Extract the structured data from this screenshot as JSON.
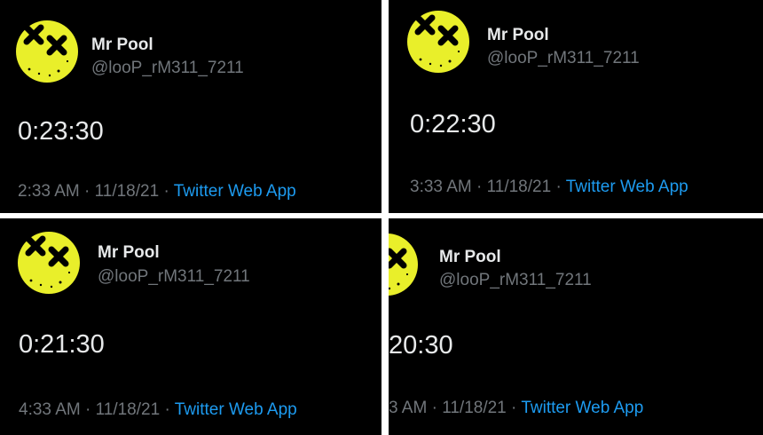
{
  "colors": {
    "background": "#000000",
    "divider": "#ffffff",
    "name": "#e7e9ea",
    "secondary": "#71767b",
    "link": "#1d9bf0",
    "avatar_face": "#e9ef2a"
  },
  "tweets": [
    {
      "name": "Mr Pool",
      "handle": "@looP_rM311_7211",
      "text": "0:23:30",
      "time": "2:33 AM",
      "sep1": "·",
      "date": "11/18/21",
      "sep2": "·",
      "source": "Twitter Web App",
      "avatar_icon": "dizzy-face-icon"
    },
    {
      "name": "Mr Pool",
      "handle": "@looP_rM311_7211",
      "text": "0:22:30",
      "time": "3:33 AM",
      "sep1": "·",
      "date": "11/18/21",
      "sep2": "·",
      "source": "Twitter Web App",
      "avatar_icon": "dizzy-face-icon"
    },
    {
      "name": "Mr Pool",
      "handle": "@looP_rM311_7211",
      "text": "0:21:30",
      "time": "4:33 AM",
      "sep1": "·",
      "date": "11/18/21",
      "sep2": "·",
      "source": "Twitter Web App",
      "avatar_icon": "dizzy-face-icon"
    },
    {
      "name": "Mr Pool",
      "handle": "@looP_rM311_7211",
      "text": "20:30",
      "time": "3 AM",
      "sep1": "·",
      "date": "11/18/21",
      "sep2": "·",
      "source": "Twitter Web App",
      "avatar_icon": "dizzy-face-icon"
    }
  ]
}
